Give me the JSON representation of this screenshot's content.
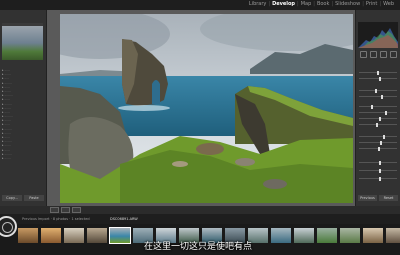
{
  "modules": [
    "Library",
    "Develop",
    "Map",
    "Book",
    "Slideshow",
    "Print",
    "Web"
  ],
  "active_module": "Develop",
  "subtitle": "在这里一切这只是使吧有点",
  "filename": "DSC06891.ARW",
  "film_info": "Previous Import · 8 photos · 1 selected",
  "left_buttons": [
    "Copy...",
    "Paste"
  ],
  "right_buttons": [
    "Previous",
    "Reset"
  ]
}
